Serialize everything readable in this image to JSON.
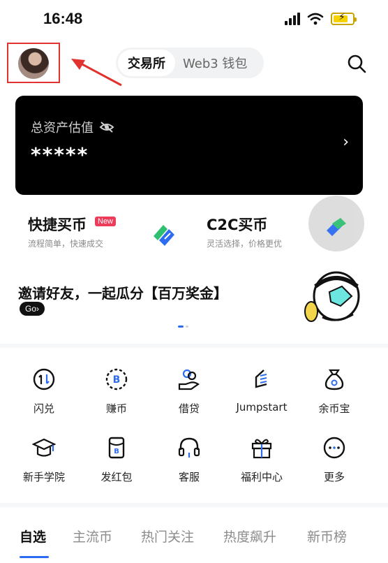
{
  "status_bar": {
    "time": "16:48"
  },
  "header": {
    "segment_active": "交易所",
    "segment_inactive": "Web3 钱包"
  },
  "asset_card": {
    "label": "总资产估值",
    "value": "*****"
  },
  "quick_buy": {
    "title": "快捷买币",
    "badge": "New",
    "subtitle": "流程简单，快速成交"
  },
  "c2c": {
    "title": "C2C买币",
    "subtitle": "灵活选择，价格更优"
  },
  "banner": {
    "title": "邀请好友，一起瓜分【百万奖金】",
    "cta": "Go›"
  },
  "grid": [
    {
      "label": "闪兑",
      "icon": "swap-icon"
    },
    {
      "label": "赚币",
      "icon": "earn-coin-icon"
    },
    {
      "label": "借贷",
      "icon": "loan-icon"
    },
    {
      "label": "Jumpstart",
      "icon": "jumpstart-icon"
    },
    {
      "label": "余币宝",
      "icon": "savings-bag-icon"
    },
    {
      "label": "新手学院",
      "icon": "graduation-cap-icon"
    },
    {
      "label": "发红包",
      "icon": "red-packet-icon"
    },
    {
      "label": "客服",
      "icon": "headset-icon"
    },
    {
      "label": "福利中心",
      "icon": "gift-icon"
    },
    {
      "label": "更多",
      "icon": "more-icon"
    }
  ],
  "tabs": [
    "自选",
    "主流币",
    "热门关注",
    "热度飙升",
    "新币榜"
  ],
  "colors": {
    "accent": "#2d6cf0",
    "badge": "#ef3b5a",
    "annotation": "#e0322f"
  }
}
